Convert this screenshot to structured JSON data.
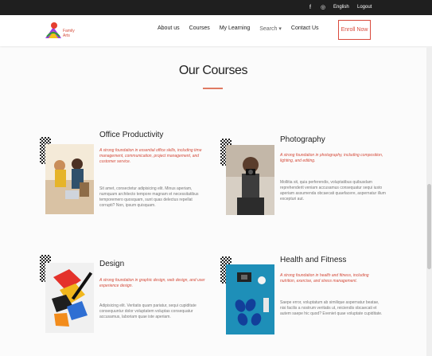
{
  "topbar": {
    "facebook_icon": "facebook-icon",
    "instagram_icon": "instagram-icon",
    "english_label": "English",
    "logout_label": "Logout"
  },
  "nav": {
    "logo_text": "Family Arts",
    "items": [
      "About us",
      "Courses",
      "My Learning",
      "Search",
      "Contact Us"
    ],
    "enroll_label": "Enroll Now"
  },
  "page": {
    "title": "Our Courses"
  },
  "courses": [
    {
      "title": "Office Productivity",
      "highlight": "A strong foundation in essential office skills, including time management, communication, project management, and customer service.",
      "body": "Sit amet, consectetur adipisicing elit. Minus aperiam, numquam architecto tempore magnam et necessitatibus temporemero quosquam, sunt quas delectus repellat corrupti? Non, ipsum quisquam."
    },
    {
      "title": "Photography",
      "highlight": "A strong foundation in photography, including composition, lighting, and editing.",
      "body": "Mollitia sit, quia perferendis, voluptatibus quibusdam reprehenderit veniam accusamus consequatur sequi iusto aperiam assumenda obcaecati quaefacere, aspernatur illum excepturi aut."
    },
    {
      "title": "Design",
      "highlight": "A strong foundation in graphic design, web design, and user experience design.",
      "body": "Adipisicing elit. Veritatis quam pariatur, sequi cupiditate consequuntur dolor voluptatem voluptas consequatur accusamus, laboriam quae iste aperiam."
    },
    {
      "title": "Health and Fitness",
      "highlight": "A strong foundation in health and fitness, including nutrition, exercise, and stress management.",
      "body": "Saepe error, voluptatum ab similique aspernatur beatae, nisi facilis a nostrum veritatis ut, reiciendis obcaecati et autem saepe hic quod? Eveniet quae voluptate cupiditate."
    }
  ],
  "colors": {
    "accent": "#d44a39",
    "dark": "#1f1f1f"
  }
}
